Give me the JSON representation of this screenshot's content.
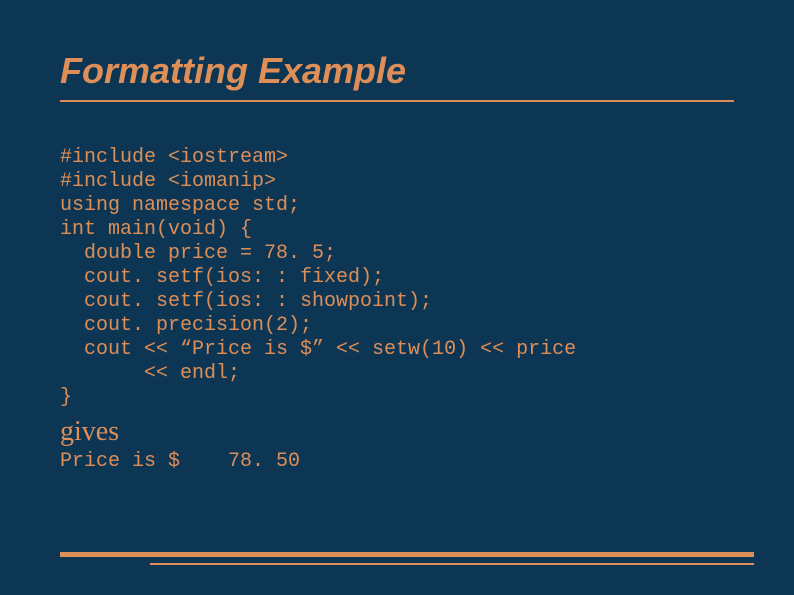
{
  "title": "Formatting Example",
  "code": {
    "l1": "#include <iostream>",
    "l2": "#include <iomanip>",
    "l3": "using namespace std;",
    "l4": "int main(void) {",
    "l5": "  double price = 78. 5;",
    "l6": "  cout. setf(ios: : fixed);",
    "l7": "  cout. setf(ios: : showpoint);",
    "l8": "  cout. precision(2);",
    "l9": "  cout << “Price is $” << setw(10) << price",
    "l10": "       << endl;",
    "l11": "}"
  },
  "gives_label": "gives",
  "output": "Price is $    78. 50"
}
